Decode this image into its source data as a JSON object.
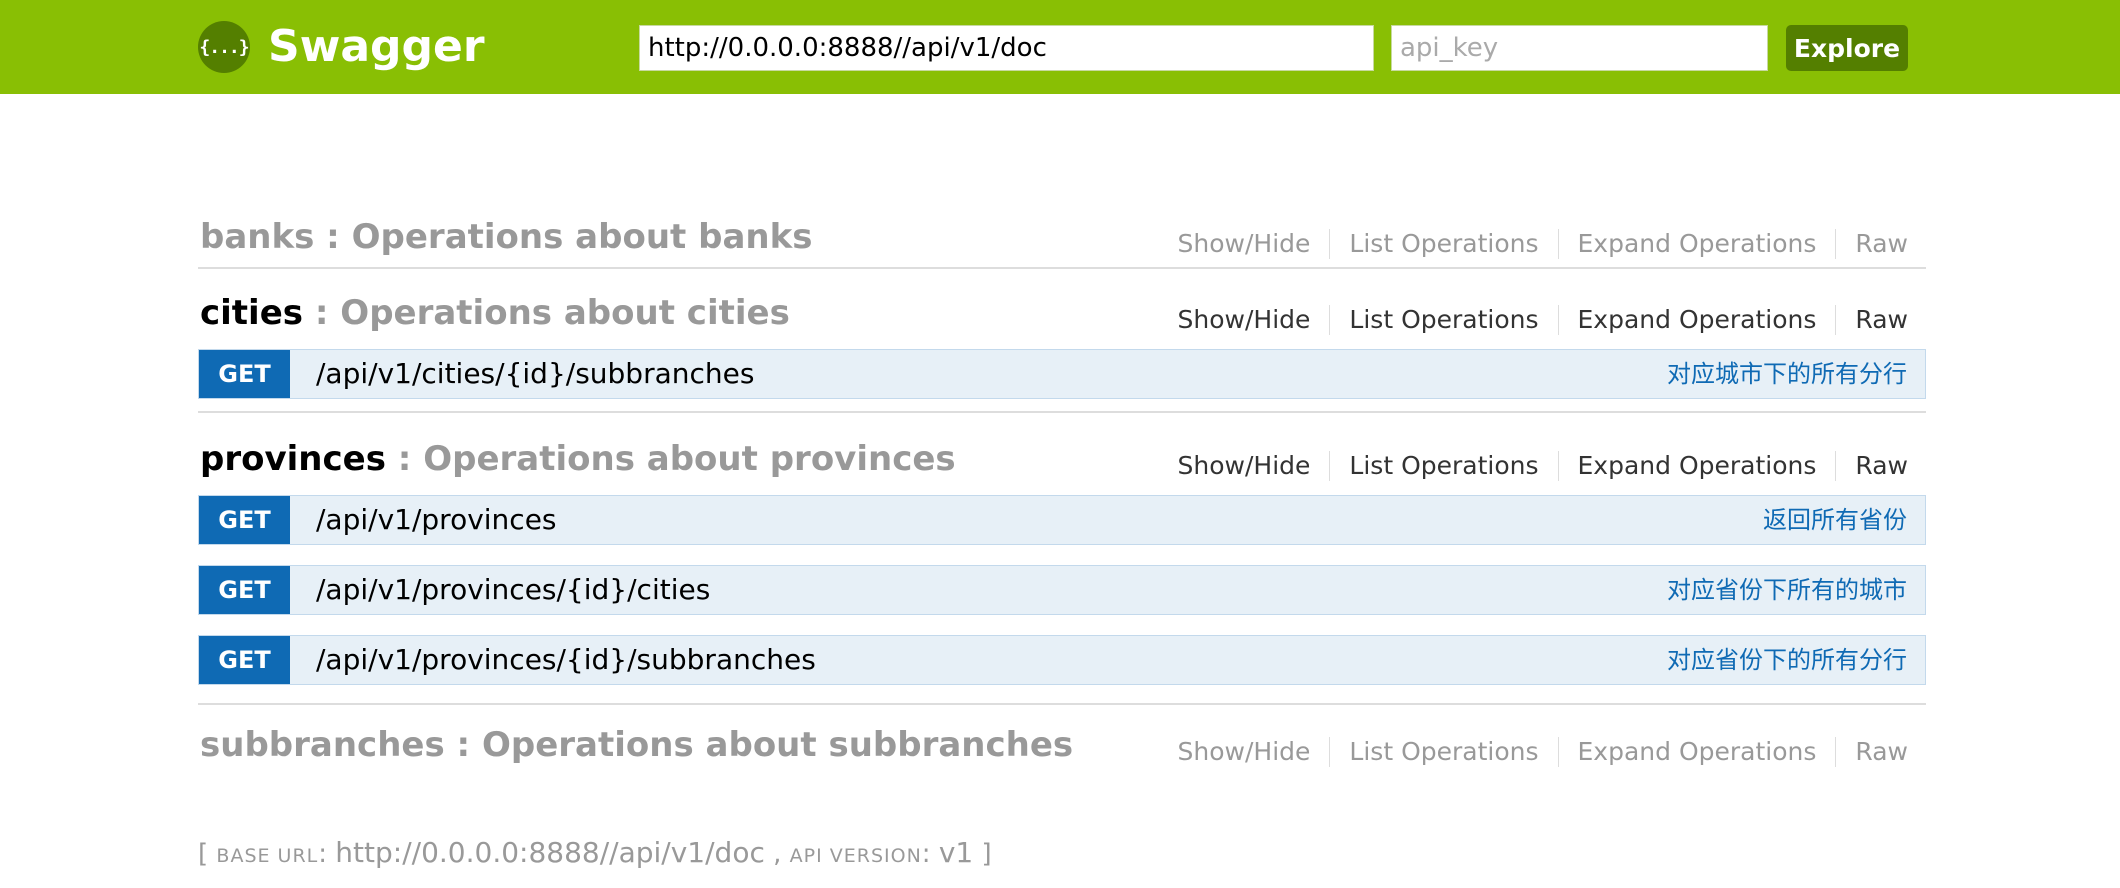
{
  "header": {
    "logo_glyph": "{...}",
    "logo_text": "Swagger",
    "url_value": "http://0.0.0.0:8888//api/v1/doc",
    "api_key_placeholder": "api_key",
    "explore_label": "Explore",
    "brand_color": "#89bf04",
    "button_color": "#547f00"
  },
  "resources": [
    {
      "name": "banks",
      "separator": " : ",
      "description": "Operations about banks",
      "actions": [
        "Show/Hide",
        "List Operations",
        "Expand Operations",
        "Raw"
      ],
      "operations": []
    },
    {
      "name": "cities",
      "separator": " : ",
      "description": "Operations about cities",
      "actions": [
        "Show/Hide",
        "List Operations",
        "Expand Operations",
        "Raw"
      ],
      "operations": [
        {
          "method": "GET",
          "path": "/api/v1/cities/{id}/subbranches",
          "summary": "对应城市下的所有分行"
        }
      ]
    },
    {
      "name": "provinces",
      "separator": " : ",
      "description": "Operations about provinces",
      "actions": [
        "Show/Hide",
        "List Operations",
        "Expand Operations",
        "Raw"
      ],
      "operations": [
        {
          "method": "GET",
          "path": "/api/v1/provinces",
          "summary": "返回所有省份"
        },
        {
          "method": "GET",
          "path": "/api/v1/provinces/{id}/cities",
          "summary": "对应省份下所有的城市"
        },
        {
          "method": "GET",
          "path": "/api/v1/provinces/{id}/subbranches",
          "summary": "对应省份下的所有分行"
        }
      ]
    },
    {
      "name": "subbranches",
      "separator": " : ",
      "description": "Operations about subbranches",
      "actions": [
        "Show/Hide",
        "List Operations",
        "Expand Operations",
        "Raw"
      ],
      "operations": []
    }
  ],
  "footer": {
    "open_bracket": "[ ",
    "base_url_label": "BASE URL",
    "colon": ": ",
    "base_url_value": "http://0.0.0.0:8888//api/v1/doc",
    "comma": " , ",
    "api_version_label": "API VERSION",
    "api_version_value": "v1",
    "close_bracket": " ]"
  },
  "colors": {
    "get_method": "#0f6ab4",
    "operation_bg": "#e7f0f7",
    "muted_text": "#999999"
  }
}
